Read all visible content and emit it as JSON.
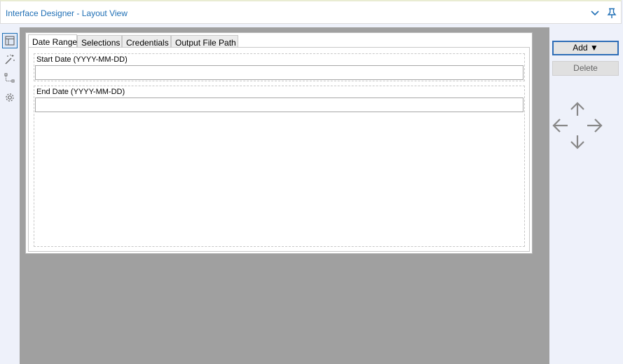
{
  "window": {
    "title": "Interface Designer - Layout View"
  },
  "left_toolbar": {
    "items": [
      {
        "icon": "layout-icon",
        "active": true
      },
      {
        "icon": "magic-wand-icon",
        "active": false
      },
      {
        "icon": "tree-icon",
        "active": false
      },
      {
        "icon": "gear-icon",
        "active": false
      }
    ]
  },
  "tabs": [
    {
      "label": "Date Range",
      "active": true
    },
    {
      "label": "Selections",
      "active": false
    },
    {
      "label": "Credentials",
      "active": false
    },
    {
      "label": "Output File Path",
      "active": false
    }
  ],
  "fields": [
    {
      "label": "Start Date (YYYY-MM-DD)",
      "value": ""
    },
    {
      "label": "End Date (YYYY-MM-DD)",
      "value": ""
    }
  ],
  "actions": {
    "add_label": "Add ▼",
    "delete_label": "Delete"
  },
  "colors": {
    "accent": "#1f6fb5",
    "canvas": "#a0a0a0",
    "sidebar": "#eef1fa"
  }
}
